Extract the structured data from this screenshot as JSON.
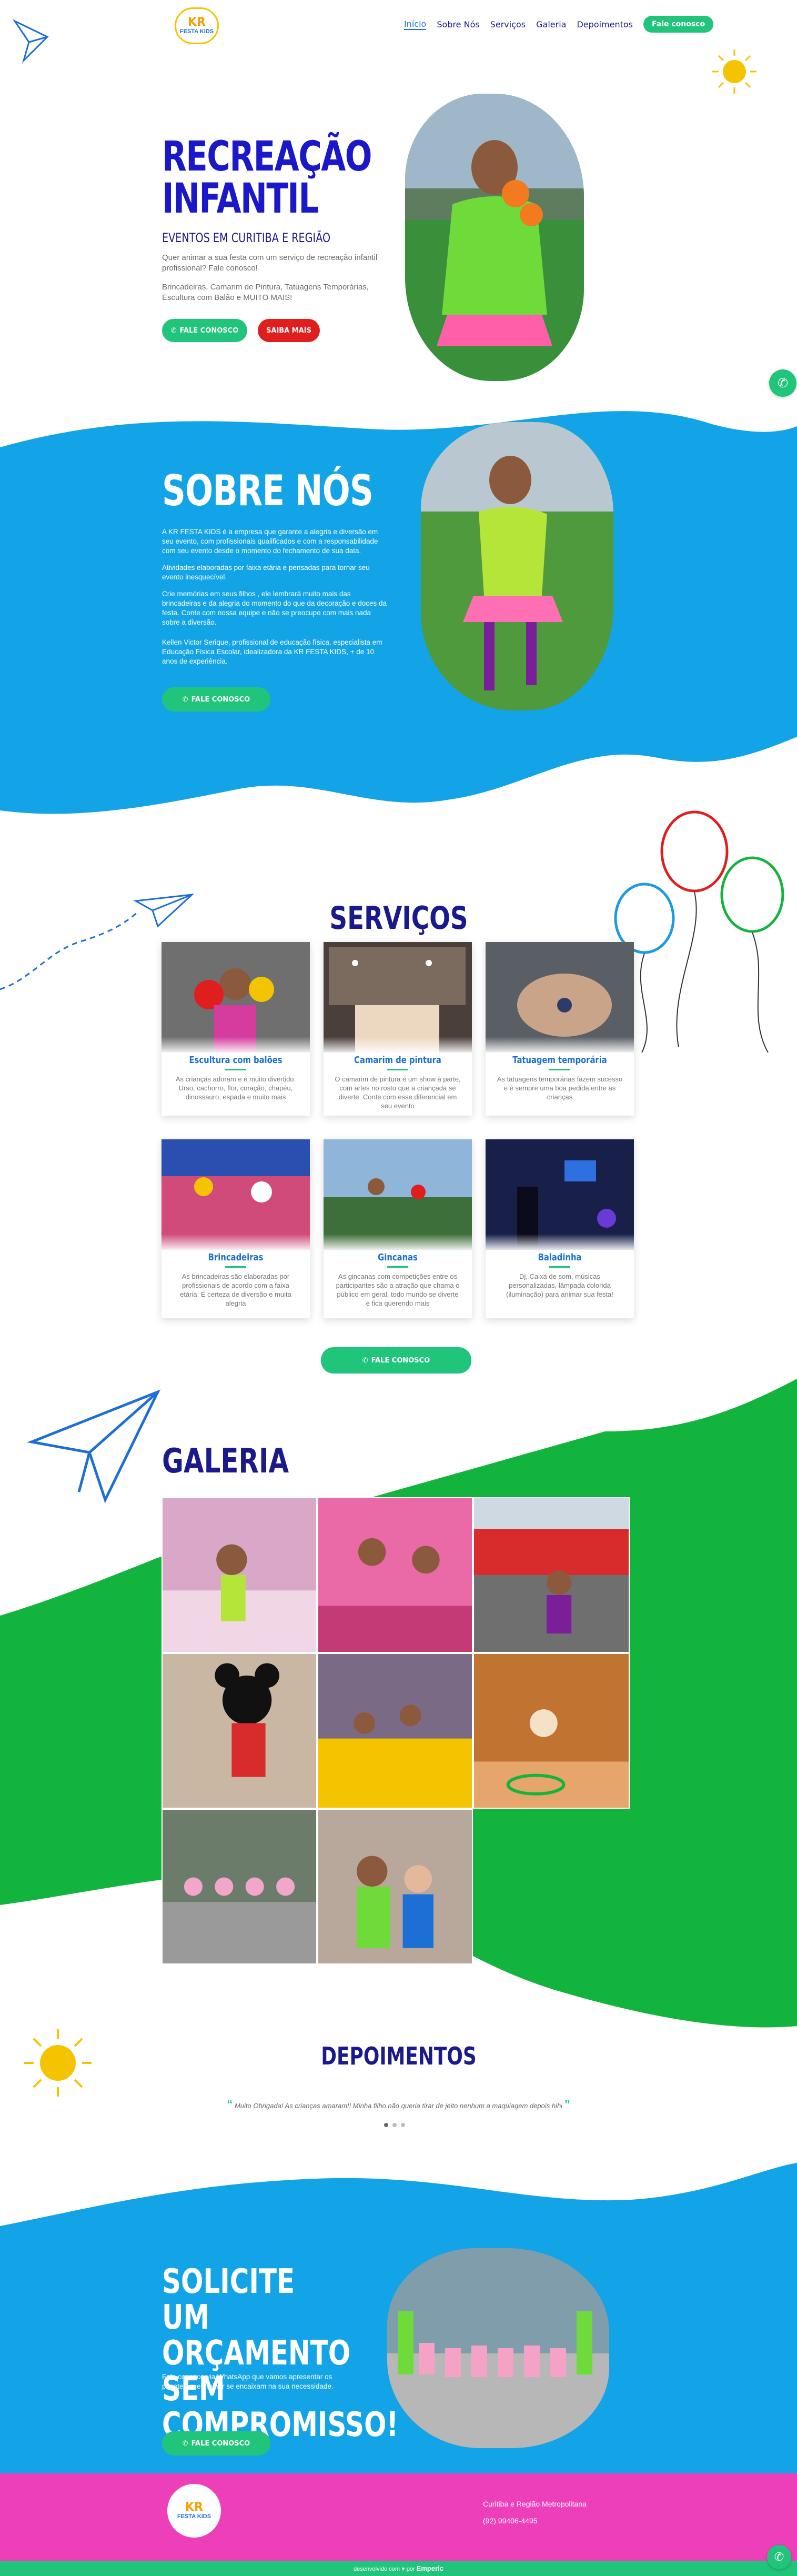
{
  "header": {
    "logo_text": "KR",
    "logo_sub": "FESTA KIDS",
    "nav": [
      {
        "label": "Início",
        "active": true
      },
      {
        "label": "Sobre Nós",
        "active": false
      },
      {
        "label": "Serviços",
        "active": false
      },
      {
        "label": "Galeria",
        "active": false
      },
      {
        "label": "Depoimentos",
        "active": false
      }
    ],
    "cta": "Fale conosco"
  },
  "hero": {
    "title_line1": "RECREAÇÃO",
    "title_line2": "INFANTIL",
    "subtitle": "EVENTOS EM CURITIBA E REGIÃO",
    "p1": "Quer animar a sua festa com um serviço de recreação infantil profissional? Fale conosco!",
    "p2": "Brincadeiras, Camarim de Pintura, Tatuagens Temporárias, Escultura com Balão e MUITO MAIS!",
    "btn_contact": "FALE CONOSCO",
    "btn_more": "SAIBA MAIS"
  },
  "sobre": {
    "title": "SOBRE NÓS",
    "p1": "A KR FESTA KIDS é a empresa que garante a alegria e diversão em seu evento, com profissionais qualificados e com a responsabilidade com seu evento desde o momento do fechamento de sua data.",
    "p2": "Atividades elaboradas por faixa etária e pensadas para tornar seu evento inesquecível.",
    "p3": "Crie memórias em seus filhos , ele lembrará muito mais das brincadeiras e da alegria do momento do que da decoração e doces da festa. Conte com nossa equipe e não se preocupe com mais nada sobre a diversão.",
    "p4": "Kellen Victor Serique, profissional de educação física, especialista em Educação Física Escolar, idealizadora da KR FESTA KIDS, + de 10 anos de experiência.",
    "btn": "FALE CONOSCO"
  },
  "servicos": {
    "title": "SERVIÇOS",
    "cards": [
      {
        "title": "Escultura com balões",
        "desc": "As crianças adoram e é muito divertido. Urso, cachorro, flor, coração, chapéu, dinossauro, espada e muito mais"
      },
      {
        "title": "Camarim de pintura",
        "desc": "O camarim de pintura é um show à parte, com artes no rosto que a criançada se diverte. Conte com esse diferencial em seu evento"
      },
      {
        "title": "Tatuagem temporária",
        "desc": "As tatuagens temporárias fazem sucesso e é sempre uma boa pedida entre as crianças"
      },
      {
        "title": "Brincadeiras",
        "desc": "As brincadeiras são elaboradas por profissionais de acordo com a faixa etária. É certeza de diversão e muita alegria"
      },
      {
        "title": "Gincanas",
        "desc": "As gincanas com competições entre os participantes são a atração que chama o público em geral, todo mundo se diverte e fica querendo mais"
      },
      {
        "title": "Baladinha",
        "desc": "Dj, Caixa de som, músicas personalizadas, lâmpada colorida (iluminação) para animar sua festa!"
      }
    ],
    "btn": "FALE CONOSCO"
  },
  "galeria": {
    "title": "GALERIA"
  },
  "depoimentos": {
    "title": "DEPOIMENTOS",
    "quote": "Muito Obrigada! As crianças amaram!! Minha filho não queria tirar de jeito nenhum a maquiagem depois hihi"
  },
  "cta": {
    "title": "SOLICITE UM ORÇAMENTO SEM COMPROMISSO!",
    "p": "Fale conosco via WhatsApp que vamos apresentar os pacotes que melhor se encaixam na sua necessidade.",
    "btn": "FALE CONOSCO"
  },
  "footer": {
    "region": "Curitiba e Região Metropolitana",
    "phone": "(92) 99406-4495",
    "credits_prefix": "desenvolvido com ♥ por",
    "credits_brand": "Emperic"
  },
  "colors": {
    "blue": "#12a4e6",
    "green": "#13b43e",
    "pink": "#ee3fbb",
    "navy": "#1a1a8c",
    "accent": "#21c47b",
    "red": "#e01e1e"
  }
}
